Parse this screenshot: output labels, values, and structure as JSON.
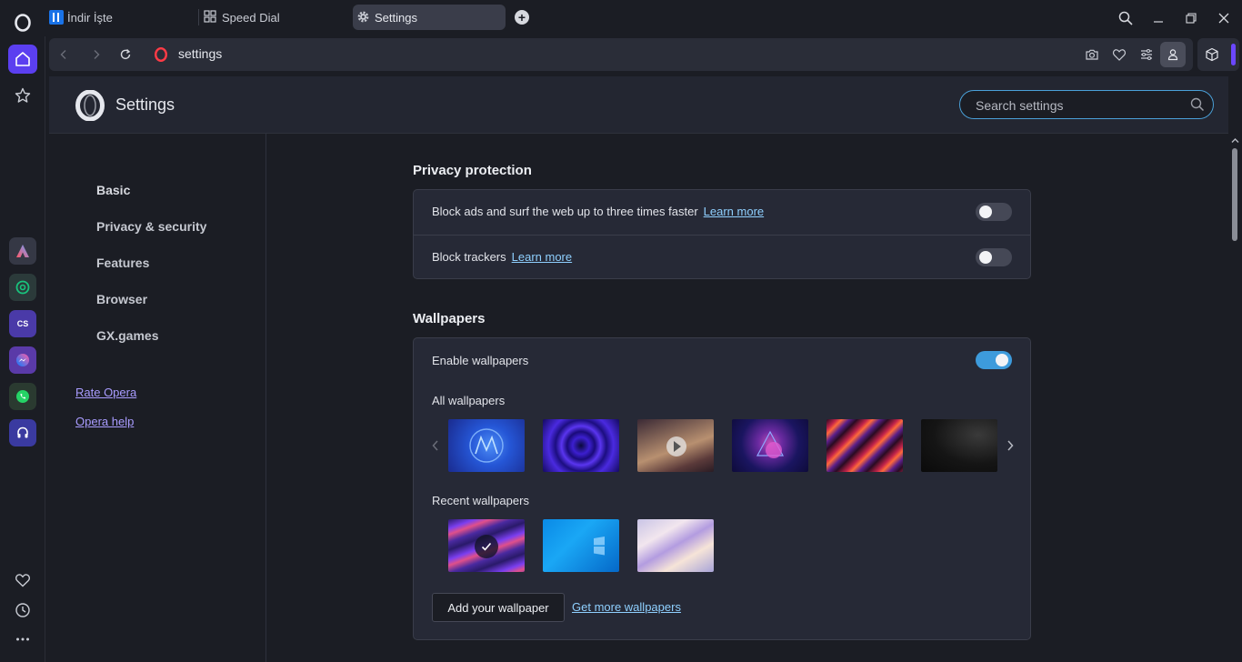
{
  "tabs": [
    {
      "label": "İndir İşte",
      "icon": "indir-favicon"
    },
    {
      "label": "Speed Dial",
      "icon": "grid-icon"
    },
    {
      "label": "Settings",
      "icon": "gear-icon"
    }
  ],
  "address": {
    "url": "settings"
  },
  "header": {
    "title": "Settings",
    "search_placeholder": "Search settings"
  },
  "nav": {
    "items": [
      "Basic",
      "Privacy & security",
      "Features",
      "Browser",
      "GX.games"
    ],
    "links": [
      "Rate Opera",
      "Opera help"
    ]
  },
  "privacy": {
    "title": "Privacy protection",
    "rows": [
      {
        "label": "Block ads and surf the web up to three times faster",
        "link": "Learn more",
        "enabled": false
      },
      {
        "label": "Block trackers",
        "link": "Learn more",
        "enabled": false
      }
    ]
  },
  "wallpapers": {
    "title": "Wallpapers",
    "enable_label": "Enable wallpapers",
    "enabled": true,
    "all_label": "All wallpapers",
    "recent_label": "Recent wallpapers",
    "add_button": "Add your wallpaper",
    "more_link": "Get more wallpapers"
  },
  "colors": {
    "accent": "#5b3ff0",
    "toggle_on": "#3d9bdc",
    "link": "#8fd0ff",
    "nav_link": "#a99cff"
  }
}
